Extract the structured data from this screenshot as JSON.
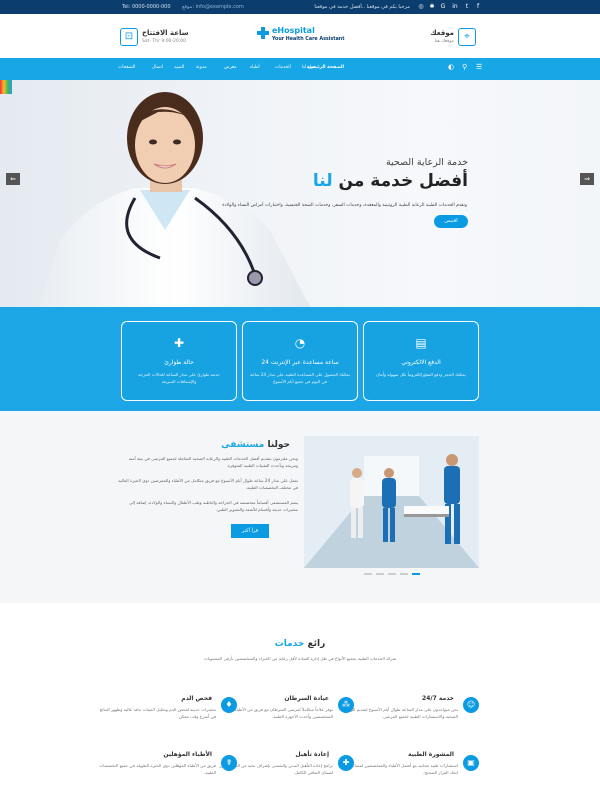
{
  "topbar": {
    "phone": "Tel: 0000-0000-000",
    "email": "موقع: info@example.com",
    "welcome": "مرحبا بكم في موقعنا ..أفضل خدمة في موقعنا"
  },
  "header": {
    "logo_name": "eHospital",
    "logo_tagline": "Your Health Care Assistant",
    "hours_title": "ساعة الافتتاح",
    "hours_text": "Sat- Thr 9:00-20:00",
    "location_title": "موقعك",
    "location_text": "موقعك هنا"
  },
  "nav": {
    "items": [
      "الصفحة الرئيسية",
      "حول لنا",
      "الخدمات",
      "أطباء",
      "معرض",
      "مدونة",
      "الصيد",
      "اتصال",
      "الصفحات"
    ]
  },
  "hero": {
    "subtitle": "خدمة الرعاية الصحية",
    "title_main": "أفضل خدمة من",
    "title_highlight": "لنا",
    "description": "ونقدم الخدمات الطبية الرعاية الطبية الروتينية والمعقدة، وخدمات السفر، وخدمات الصحة الجنسية، واختبارات أمراض النساء والولادة",
    "button": "اقتبس"
  },
  "services": [
    {
      "icon": "wallet-card-icon",
      "title": "الدفع الالكتروني",
      "desc": "يمكنك الحجز ودفع المبلغ إلكترونياً بكل سهولة وأمان"
    },
    {
      "icon": "clock-24-icon",
      "title": "24 ساعة مساعدة عبر الإنترنت",
      "desc": "يمكنك الحصول على المساعدة الطبية على مدار 24 ساعة في اليوم في جميع أيام الأسبوع"
    },
    {
      "icon": "ambulance-icon",
      "title": "حالة طوارئ",
      "desc": "خدمة طوارئ على مدار الساعة للحالات الحرجة والإسعافات السريعة"
    }
  ],
  "about": {
    "title": "حولنا",
    "title_highlight": "مستشفى",
    "p1": "ونحن ملتزمون بتقديم أفضل الخدمات الطبية والرعاية الصحية الشاملة لجميع المرضى في بيئة آمنة ومريحة وبأحدث التقنيات الطبية المتوفرة.",
    "p2": "نعمل على مدار 24 ساعة طوال أيام الأسبوع مع فريق متكامل من الأطباء والممرضين ذوي الخبرة العالية في مختلف التخصصات الطبية.",
    "p3": "يضم المستشفى أقساماً متخصصة في الجراحة والباطنة وطب الأطفال والنساء والولادة، إضافة إلى مختبرات حديثة وأقسام للأشعة والتصوير الطبي.",
    "button": "قرأ أكثر"
  },
  "features": {
    "title": "رائع",
    "title_highlight": "خدمات",
    "subtitle": "شركة الخدمات الطبية بجميع الأنواع في ظل إدارة القيادة لأقل رعاية من الخبراء والمتخصصين بأرقى المستويات",
    "items": [
      {
        "icon": "doctor-icon",
        "title": "24/7 خدمة",
        "desc": "نحن متواجدون على مدار الساعة طوال أيام الأسبوع لتقديم الرعاية الصحية والاستشارات الطبية لجميع المرضى."
      },
      {
        "icon": "molecule-icon",
        "title": "عيادة السرطان",
        "desc": "نوفر علاجاً متكاملاً لمرضى السرطان مع فريق من الأطباء المتخصصين وأحدث الأجهزة الطبية."
      },
      {
        "icon": "blood-drop-icon",
        "title": "فحص الدم",
        "desc": "مختبرات حديثة لفحص الدم وتحليل العينات بدقة عالية وظهور النتائج في أسرع وقت ممكن."
      },
      {
        "icon": "book-icon",
        "title": "المشورة الطبية",
        "desc": "استشارات طبية مجانية مع أفضل الأطباء والمتخصصين لمساعدتك في اتخاذ القرار الصحيح."
      },
      {
        "icon": "lifebuoy-icon",
        "title": "إعادة تأهيل",
        "desc": "برامج إعادة التأهيل البدني والنفسي بإشراف نخبة من المتخصصين لضمان التعافي الكامل."
      },
      {
        "icon": "nurse-icon",
        "title": "الأطباء المؤهلين",
        "desc": "فريق من الأطباء المؤهلين ذوي الخبرة الطويلة في جميع التخصصات الطبية."
      }
    ]
  }
}
